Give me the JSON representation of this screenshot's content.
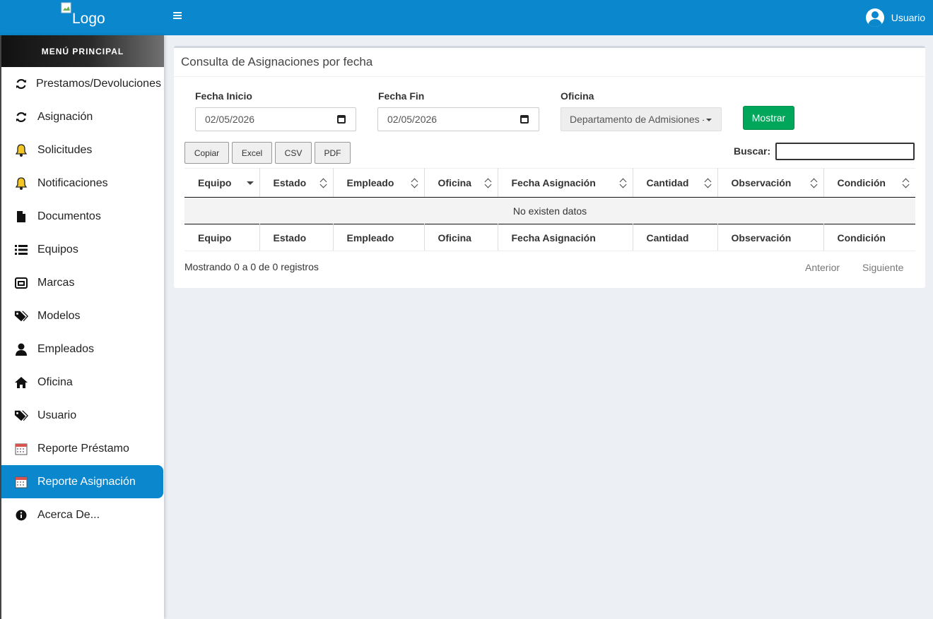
{
  "header": {
    "logo_alt": "Logo",
    "user_name": "Usuario"
  },
  "sidebar": {
    "title": "MENÚ PRINCIPAL",
    "items": [
      {
        "label": "Prestamos/Devoluciones",
        "icon": "refresh-icon"
      },
      {
        "label": "Asignación",
        "icon": "refresh-icon"
      },
      {
        "label": "Solicitudes",
        "icon": "bell-icon"
      },
      {
        "label": "Notificaciones",
        "icon": "bell-icon"
      },
      {
        "label": "Documentos",
        "icon": "file-icon"
      },
      {
        "label": "Equipos",
        "icon": "list-icon"
      },
      {
        "label": "Marcas",
        "icon": "window-icon"
      },
      {
        "label": "Modelos",
        "icon": "tags-icon"
      },
      {
        "label": "Empleados",
        "icon": "user-icon"
      },
      {
        "label": "Oficina",
        "icon": "home-icon"
      },
      {
        "label": "Usuario",
        "icon": "tags-icon"
      },
      {
        "label": "Reporte Préstamo",
        "icon": "calendar-icon"
      },
      {
        "label": "Reporte Asignación",
        "icon": "calendar-icon",
        "active": true
      },
      {
        "label": "Acerca De...",
        "icon": "info-icon"
      }
    ]
  },
  "main": {
    "title": "Consulta de Asignaciones por fecha",
    "form": {
      "fecha_inicio_label": "Fecha Inicio",
      "fecha_inicio_value": "02/05/2026",
      "fecha_fin_label": "Fecha Fin",
      "fecha_fin_value": "02/05/2026",
      "oficina_label": "Oficina",
      "oficina_value": "Departamento de Admisiones -",
      "show_button": "Mostrar"
    },
    "export_buttons": [
      "Copiar",
      "Excel",
      "CSV",
      "PDF"
    ],
    "search_label": "Buscar:",
    "table": {
      "columns": [
        "Equipo",
        "Estado",
        "Empleado",
        "Oficina",
        "Fecha Asignación",
        "Cantidad",
        "Observación",
        "Condición"
      ],
      "empty_message": "No existen datos"
    },
    "info": "Mostrando 0 a 0 de 0 registros",
    "pager": {
      "prev": "Anterior",
      "next": "Siguiente"
    }
  },
  "colors": {
    "primary": "#0a87cd",
    "success": "#00a65a",
    "background": "#ecf0f5"
  }
}
